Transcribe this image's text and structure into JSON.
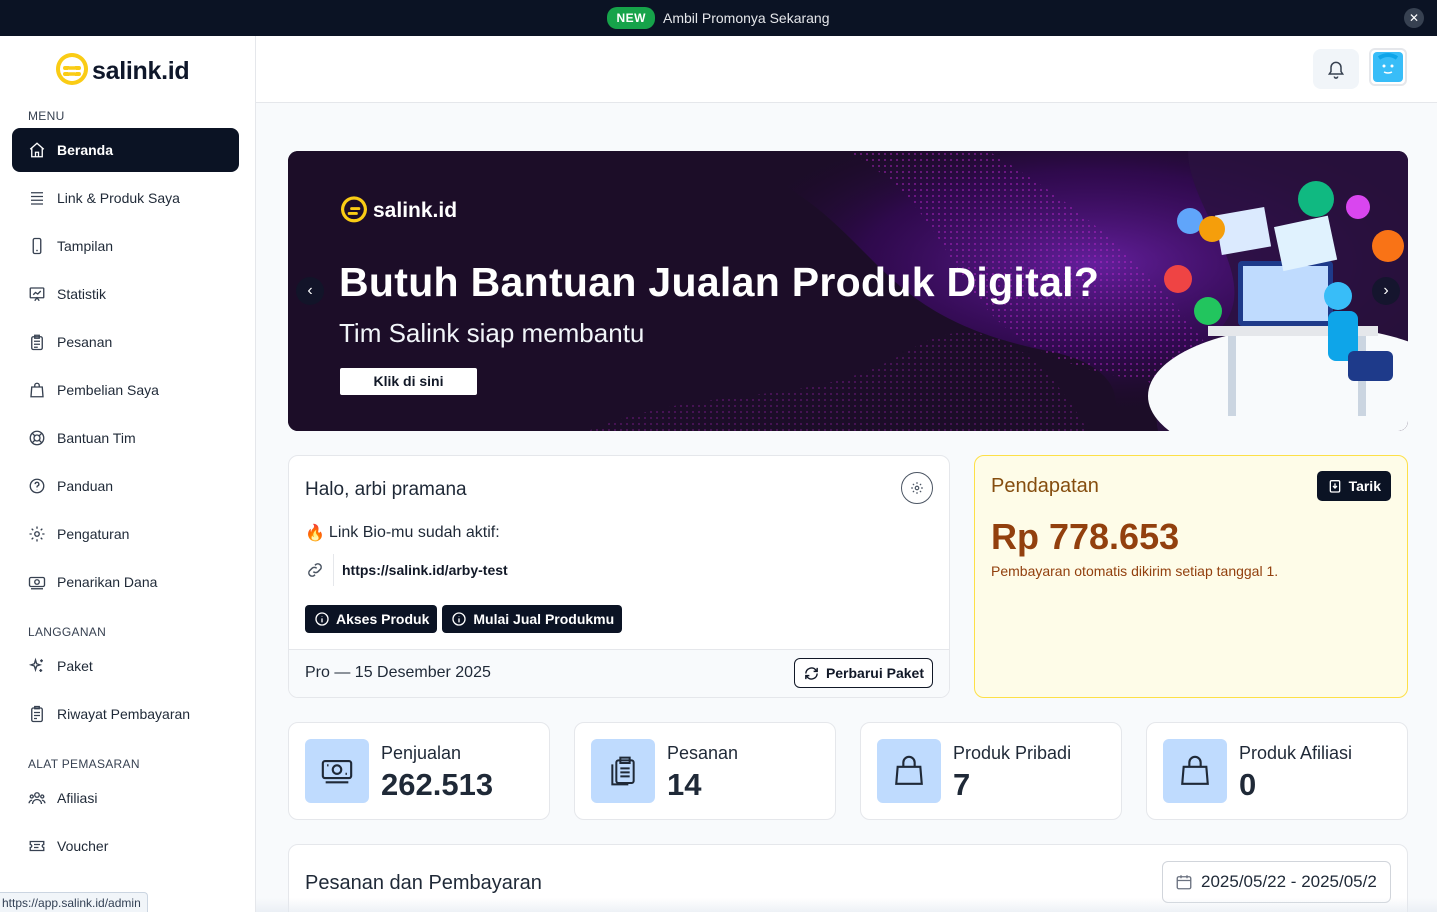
{
  "promo": {
    "badge": "NEW",
    "text": "Ambil Promonya Sekarang",
    "close": "✕"
  },
  "brand": {
    "name": "salink.id",
    "accent": "#facc15",
    "dark": "#0b1324"
  },
  "sidebar": {
    "sections": [
      {
        "label": "MENU"
      },
      {
        "label": "LANGGANAN"
      },
      {
        "label": "ALAT PEMASARAN"
      }
    ],
    "items": [
      {
        "label": "Beranda",
        "icon": "home-icon",
        "active": true
      },
      {
        "label": "Link & Produk Saya",
        "icon": "list-icon"
      },
      {
        "label": "Tampilan",
        "icon": "phone-icon"
      },
      {
        "label": "Statistik",
        "icon": "chart-icon"
      },
      {
        "label": "Pesanan",
        "icon": "clipboard-icon"
      },
      {
        "label": "Pembelian Saya",
        "icon": "bag-icon"
      },
      {
        "label": "Bantuan Tim",
        "icon": "lifebuoy-icon"
      },
      {
        "label": "Panduan",
        "icon": "question-icon"
      },
      {
        "label": "Pengaturan",
        "icon": "gear-icon"
      },
      {
        "label": "Penarikan Dana",
        "icon": "cash-icon"
      },
      {
        "label": "Paket",
        "icon": "sparkles-icon"
      },
      {
        "label": "Riwayat Pembayaran",
        "icon": "receipt-icon"
      },
      {
        "label": "Afiliasi",
        "icon": "users-icon"
      },
      {
        "label": "Voucher",
        "icon": "ticket-icon"
      }
    ]
  },
  "status_url": "https://app.salink.id/admin",
  "banner": {
    "brand": "salink.id",
    "headline": "Butuh Bantuan Jualan Produk Digital?",
    "subline": "Tim Salink siap membantu",
    "cta": "Klik di sini",
    "prev": "‹",
    "next": "›"
  },
  "greeting": {
    "title": "Halo, arbi pramana",
    "active_text": "Link Bio-mu sudah aktif:",
    "fire": "🔥",
    "url": "https://salink.id/arby-test",
    "buttons": [
      "Akses Produk",
      "Mulai Jual Produkmu"
    ],
    "plan": "Pro — 15 Desember 2025",
    "renew": "Perbarui Paket"
  },
  "income": {
    "title": "Pendapatan",
    "withdraw": "Tarik",
    "amount": "Rp 778.653",
    "note": "Pembayaran otomatis dikirim setiap tanggal 1."
  },
  "stats": [
    {
      "label": "Penjualan",
      "value": "262.513",
      "icon": "money-icon"
    },
    {
      "label": "Pesanan",
      "value": "14",
      "icon": "clipboard-icon"
    },
    {
      "label": "Produk Pribadi",
      "value": "7",
      "icon": "bag-icon"
    },
    {
      "label": "Produk Afiliasi",
      "value": "0",
      "icon": "bag-icon"
    }
  ],
  "orders": {
    "title": "Pesanan dan Pembayaran",
    "date_range": "2025/05/22 - 2025/05/2"
  }
}
